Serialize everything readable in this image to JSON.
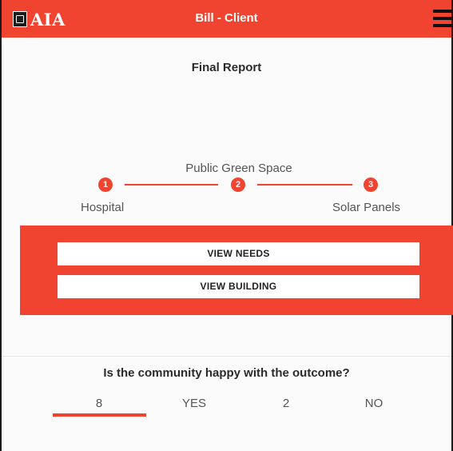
{
  "header": {
    "logo_text": "AIA",
    "title": "Bill - Client",
    "menu_icon": "hamburger-menu-icon"
  },
  "report": {
    "title": "Final Report"
  },
  "progress": {
    "steps": [
      {
        "number": "1",
        "label": "Hospital"
      },
      {
        "number": "2",
        "label": "Public Green Space"
      },
      {
        "number": "3",
        "label": "Solar Panels"
      }
    ]
  },
  "actions": {
    "view_needs": "VIEW NEEDS",
    "view_building": "VIEW BUILDING"
  },
  "survey": {
    "question": "Is the community happy with the outcome?",
    "yes_count": "8",
    "yes_label": "YES",
    "no_count": "2",
    "no_label": "NO"
  },
  "colors": {
    "accent": "#f04431",
    "background": "#fbfbfb"
  }
}
